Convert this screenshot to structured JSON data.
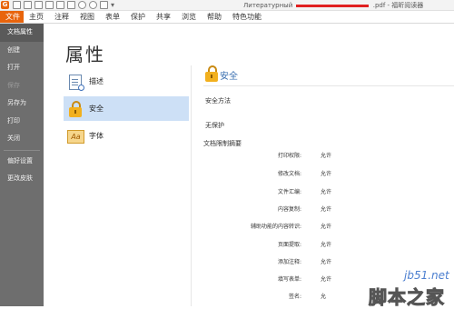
{
  "window": {
    "title_prefix": "Литературный",
    "title_suffix": ".pdf - 福昕阅读器"
  },
  "ribbon": {
    "tabs": [
      "文件",
      "主页",
      "注释",
      "视图",
      "表单",
      "保护",
      "共享",
      "浏览",
      "帮助",
      "特色功能"
    ],
    "active_tab": "文件",
    "accent": "#e8640c"
  },
  "backstage_nav": {
    "items": [
      {
        "label": "文档属性",
        "state": "active"
      },
      {
        "label": "创建",
        "state": "normal"
      },
      {
        "label": "打开",
        "state": "normal"
      },
      {
        "label": "保存",
        "state": "disabled"
      },
      {
        "label": "另存为",
        "state": "normal"
      },
      {
        "label": "打印",
        "state": "normal"
      },
      {
        "label": "关闭",
        "state": "normal"
      },
      {
        "label": "偏好设置",
        "state": "normal"
      },
      {
        "label": "更改皮肤",
        "state": "normal"
      }
    ]
  },
  "properties": {
    "heading": "属性",
    "categories": [
      {
        "label": "描述",
        "icon": "document-info-icon"
      },
      {
        "label": "安全",
        "icon": "lock-icon",
        "selected": true
      },
      {
        "label": "字体",
        "icon": "font-icon"
      }
    ]
  },
  "security": {
    "title": "安全",
    "method_label": "安全方法",
    "method_value": "无保护",
    "summary_label": "文档限制摘要",
    "restrictions": [
      {
        "label": "打印权限:",
        "value": "允许"
      },
      {
        "label": "修改文档:",
        "value": "允许"
      },
      {
        "label": "文件汇编:",
        "value": "允许"
      },
      {
        "label": "内容复制:",
        "value": "允许"
      },
      {
        "label": "辅助功能的内容转识:",
        "value": "允许"
      },
      {
        "label": "页面提取:",
        "value": "允许"
      },
      {
        "label": "添加注释:",
        "value": "允许"
      },
      {
        "label": "填写表单:",
        "value": "允许"
      },
      {
        "label": "签名:",
        "value": "允"
      }
    ]
  },
  "watermark": {
    "site": "jb51.net",
    "brand": "脚本之家"
  }
}
